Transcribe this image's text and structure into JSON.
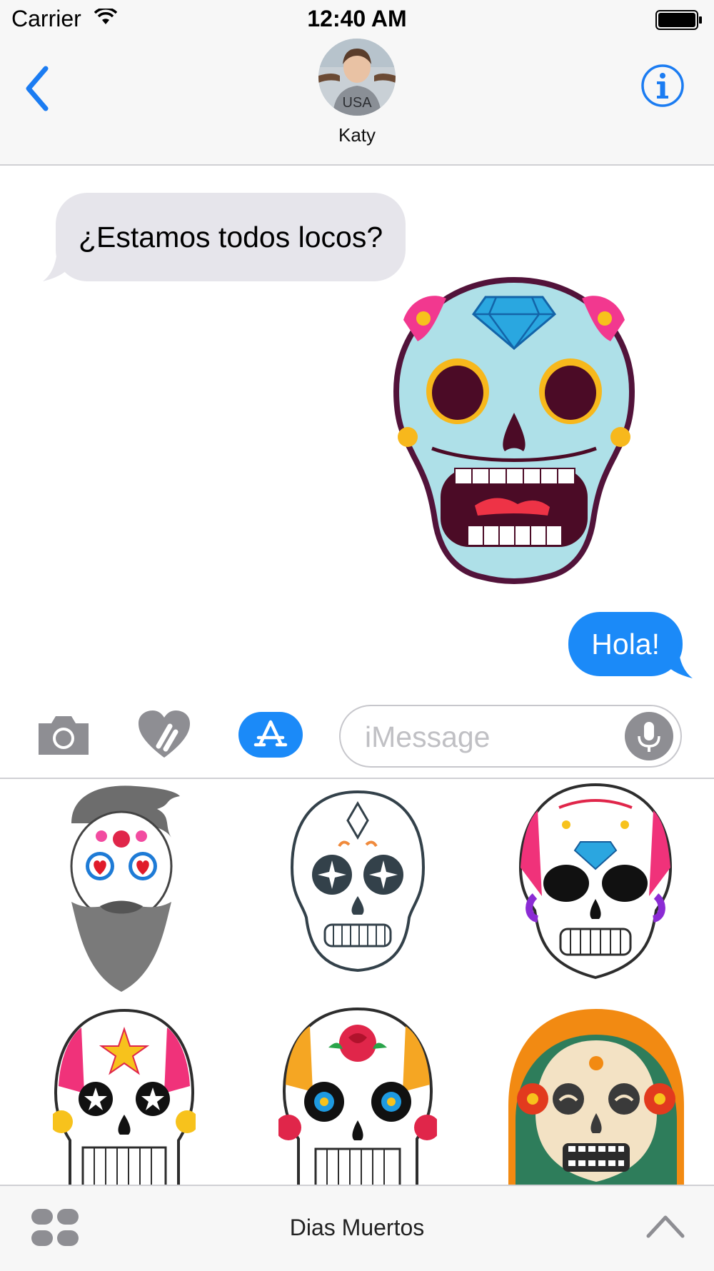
{
  "status_bar": {
    "carrier": "Carrier",
    "time": "12:40 AM"
  },
  "nav": {
    "contact_name": "Katy",
    "back_icon": "chevron-left-icon",
    "info_icon": "info-icon"
  },
  "conversation": {
    "incoming_message": "¿Estamos todos locos?",
    "outgoing_message": "Hola!"
  },
  "composer": {
    "placeholder": "iMessage",
    "icons": [
      "camera-icon",
      "digital-touch-heart-icon",
      "app-store-icon",
      "microphone-icon"
    ]
  },
  "drawer": {
    "title": "Dias Muertos",
    "icons": [
      "apps-grid-icon",
      "chevron-up-icon"
    ]
  },
  "colors": {
    "accent": "#1b8af8",
    "incoming_bubble": "#e6e5eb",
    "bar_background": "#f7f7f7"
  }
}
